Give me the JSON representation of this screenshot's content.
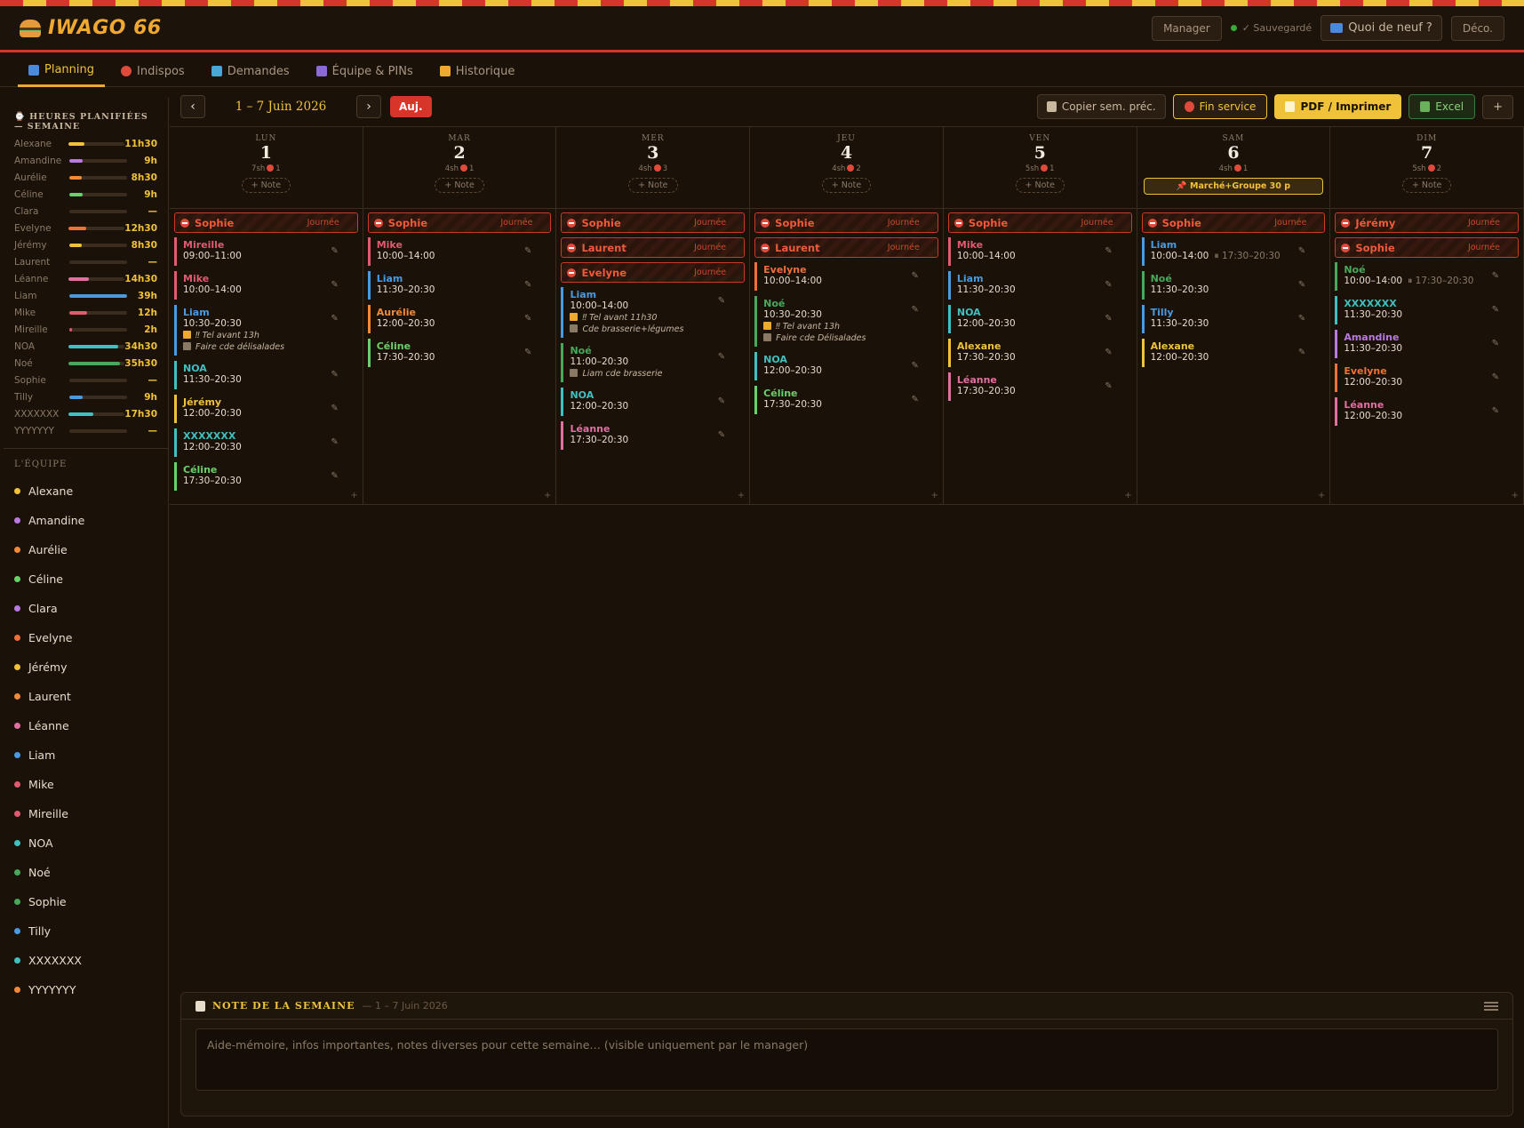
{
  "app": {
    "name": "IWAGO 66",
    "role": "Manager",
    "saved": "✓ Sauvegardé",
    "news": "Quoi de neuf ?",
    "logout": "Déco."
  },
  "tabs": [
    {
      "label": "Planning",
      "icon": "calendar-icon",
      "color": "#4a8ad8"
    },
    {
      "label": "Indispos",
      "icon": "no-entry-icon",
      "color": "#e04a3a"
    },
    {
      "label": "Demandes",
      "icon": "inbox-icon",
      "color": "#4aa8d8"
    },
    {
      "label": "Équipe & PINs",
      "icon": "people-icon",
      "color": "#8a6ad8"
    },
    {
      "label": "Historique",
      "icon": "scroll-icon",
      "color": "#f0a830"
    }
  ],
  "sidebar": {
    "hours_title": "⌚ HEURES PLANIFIÉES — SEMAINE",
    "team_title": "L'ÉQUIPE",
    "hours": [
      {
        "name": "Alexane",
        "value": "11h30",
        "ratio": 0.29,
        "color": "#f0c23a"
      },
      {
        "name": "Amandine",
        "value": "9h",
        "ratio": 0.23,
        "color": "#b87ae0"
      },
      {
        "name": "Aurélie",
        "value": "8h30",
        "ratio": 0.22,
        "color": "#f08a3a"
      },
      {
        "name": "Céline",
        "value": "9h",
        "ratio": 0.23,
        "color": "#6ad06a"
      },
      {
        "name": "Clara",
        "value": "—",
        "ratio": 0,
        "color": "#b87ae0"
      },
      {
        "name": "Evelyne",
        "value": "12h30",
        "ratio": 0.32,
        "color": "#f0703a"
      },
      {
        "name": "Jérémy",
        "value": "8h30",
        "ratio": 0.22,
        "color": "#f0c23a"
      },
      {
        "name": "Laurent",
        "value": "—",
        "ratio": 0,
        "color": "#f08a3a"
      },
      {
        "name": "Léanne",
        "value": "14h30",
        "ratio": 0.37,
        "color": "#e070a0"
      },
      {
        "name": "Liam",
        "value": "39h",
        "ratio": 1.0,
        "color": "#4a9ae0"
      },
      {
        "name": "Mike",
        "value": "12h",
        "ratio": 0.31,
        "color": "#e05a70"
      },
      {
        "name": "Mireille",
        "value": "2h",
        "ratio": 0.05,
        "color": "#e05a70"
      },
      {
        "name": "NOA",
        "value": "34h30",
        "ratio": 0.88,
        "color": "#40c0c0"
      },
      {
        "name": "Noé",
        "value": "35h30",
        "ratio": 0.91,
        "color": "#4aa85a"
      },
      {
        "name": "Sophie",
        "value": "—",
        "ratio": 0,
        "color": "#4aa85a"
      },
      {
        "name": "Tilly",
        "value": "9h",
        "ratio": 0.23,
        "color": "#4a9ae0"
      },
      {
        "name": "XXXXXXX",
        "value": "17h30",
        "ratio": 0.45,
        "color": "#40c0c0"
      },
      {
        "name": "YYYYYYY",
        "value": "—",
        "ratio": 0,
        "color": "#f08a3a"
      }
    ],
    "team": [
      {
        "name": "Alexane",
        "color": "#f0c23a"
      },
      {
        "name": "Amandine",
        "color": "#b87ae0"
      },
      {
        "name": "Aurélie",
        "color": "#f08a3a"
      },
      {
        "name": "Céline",
        "color": "#6ad06a"
      },
      {
        "name": "Clara",
        "color": "#b87ae0"
      },
      {
        "name": "Evelyne",
        "color": "#f0703a"
      },
      {
        "name": "Jérémy",
        "color": "#f0c23a"
      },
      {
        "name": "Laurent",
        "color": "#f08a3a"
      },
      {
        "name": "Léanne",
        "color": "#e070a0"
      },
      {
        "name": "Liam",
        "color": "#4a9ae0"
      },
      {
        "name": "Mike",
        "color": "#e05a70"
      },
      {
        "name": "Mireille",
        "color": "#e05a70"
      },
      {
        "name": "NOA",
        "color": "#40c0c0"
      },
      {
        "name": "Noé",
        "color": "#4aa85a"
      },
      {
        "name": "Sophie",
        "color": "#4aa85a"
      },
      {
        "name": "Tilly",
        "color": "#4a9ae0"
      },
      {
        "name": "XXXXXXX",
        "color": "#40c0c0"
      },
      {
        "name": "YYYYYYY",
        "color": "#f08a3a"
      }
    ]
  },
  "toolbar": {
    "prev": "‹",
    "next": "›",
    "range": "1 – 7 Juin 2026",
    "today": "Auj.",
    "copy": "Copier sem. préc.",
    "end_service": "Fin service",
    "pdf": "PDF / Imprimer",
    "excel": "Excel",
    "add": "+"
  },
  "days": [
    {
      "name": "LUN",
      "num": "1",
      "hours": "7sh",
      "abs": "1",
      "note": "+ Note",
      "absences": [
        {
          "name": "Sophie",
          "type": "Journée"
        }
      ],
      "shifts": [
        {
          "name": "Mireille",
          "time": "09:00–11:00",
          "color": "#e05a70"
        },
        {
          "name": "Mike",
          "time": "10:00–14:00",
          "color": "#e05a70"
        },
        {
          "name": "Liam",
          "time": "10:30–20:30",
          "color": "#4a9ae0",
          "notes": [
            "‼ Tel avant 13h",
            "Faire cde délisalades"
          ]
        },
        {
          "name": "NOA",
          "time": "11:30–20:30",
          "color": "#40c0c0"
        },
        {
          "name": "Jérémy",
          "time": "12:00–20:30",
          "color": "#f0c23a"
        },
        {
          "name": "XXXXXXX",
          "time": "12:00–20:30",
          "color": "#40c0c0"
        },
        {
          "name": "Céline",
          "time": "17:30–20:30",
          "color": "#6ad06a"
        }
      ]
    },
    {
      "name": "MAR",
      "num": "2",
      "hours": "4sh",
      "abs": "1",
      "note": "+ Note",
      "absences": [
        {
          "name": "Sophie",
          "type": "Journée"
        }
      ],
      "shifts": [
        {
          "name": "Mike",
          "time": "10:00–14:00",
          "color": "#e05a70"
        },
        {
          "name": "Liam",
          "time": "11:30–20:30",
          "color": "#4a9ae0"
        },
        {
          "name": "Aurélie",
          "time": "12:00–20:30",
          "color": "#f08a3a"
        },
        {
          "name": "Céline",
          "time": "17:30–20:30",
          "color": "#6ad06a"
        }
      ]
    },
    {
      "name": "MER",
      "num": "3",
      "hours": "4sh",
      "abs": "3",
      "note": "+ Note",
      "absences": [
        {
          "name": "Sophie",
          "type": "Journée"
        },
        {
          "name": "Laurent",
          "type": "Journée"
        },
        {
          "name": "Evelyne",
          "type": "Journée"
        }
      ],
      "shifts": [
        {
          "name": "Liam",
          "time": "10:00–14:00",
          "color": "#4a9ae0",
          "notes": [
            "‼ Tel avant 11h30",
            "Cde brasserie+légumes"
          ]
        },
        {
          "name": "Noé",
          "time": "11:00–20:30",
          "color": "#4aa85a",
          "notes": [
            "Liam cde brasserie"
          ]
        },
        {
          "name": "NOA",
          "time": "12:00–20:30",
          "color": "#40c0c0"
        },
        {
          "name": "Léanne",
          "time": "17:30–20:30",
          "color": "#e070a0"
        }
      ]
    },
    {
      "name": "JEU",
      "num": "4",
      "hours": "4sh",
      "abs": "2",
      "note": "+ Note",
      "absences": [
        {
          "name": "Sophie",
          "type": "Journée"
        },
        {
          "name": "Laurent",
          "type": "Journée"
        }
      ],
      "shifts": [
        {
          "name": "Evelyne",
          "time": "10:00–14:00",
          "color": "#f0703a"
        },
        {
          "name": "Noé",
          "time": "10:30–20:30",
          "color": "#4aa85a",
          "notes": [
            "‼ Tel avant 13h",
            "Faire cde Délisalades"
          ]
        },
        {
          "name": "NOA",
          "time": "12:00–20:30",
          "color": "#40c0c0"
        },
        {
          "name": "Céline",
          "time": "17:30–20:30",
          "color": "#6ad06a"
        }
      ]
    },
    {
      "name": "VEN",
      "num": "5",
      "hours": "5sh",
      "abs": "1",
      "note": "+ Note",
      "absences": [
        {
          "name": "Sophie",
          "type": "Journée"
        }
      ],
      "shifts": [
        {
          "name": "Mike",
          "time": "10:00–14:00",
          "color": "#e05a70"
        },
        {
          "name": "Liam",
          "time": "11:30–20:30",
          "color": "#4a9ae0"
        },
        {
          "name": "NOA",
          "time": "12:00–20:30",
          "color": "#40c0c0"
        },
        {
          "name": "Alexane",
          "time": "17:30–20:30",
          "color": "#f0c23a"
        },
        {
          "name": "Léanne",
          "time": "17:30–20:30",
          "color": "#e070a0"
        }
      ]
    },
    {
      "name": "SAM",
      "num": "6",
      "hours": "4sh",
      "abs": "1",
      "event": "📌 Marché+Groupe 30 p",
      "absences": [
        {
          "name": "Sophie",
          "type": "Journée"
        }
      ],
      "shifts": [
        {
          "name": "Liam",
          "time": "10:00–14:00",
          "time2": "⏸ 17:30–20:30",
          "color": "#4a9ae0"
        },
        {
          "name": "Noé",
          "time": "11:30–20:30",
          "color": "#4aa85a"
        },
        {
          "name": "Tilly",
          "time": "11:30–20:30",
          "color": "#4a9ae0"
        },
        {
          "name": "Alexane",
          "time": "12:00–20:30",
          "color": "#f0c23a"
        }
      ]
    },
    {
      "name": "DIM",
      "num": "7",
      "hours": "5sh",
      "abs": "2",
      "note": "+ Note",
      "absences": [
        {
          "name": "Jérémy",
          "type": "Journée"
        },
        {
          "name": "Sophie",
          "type": "Journée"
        }
      ],
      "shifts": [
        {
          "name": "Noé",
          "time": "10:00–14:00",
          "time2": "⏸ 17:30–20:30",
          "color": "#4aa85a"
        },
        {
          "name": "XXXXXXX",
          "time": "11:30–20:30",
          "color": "#40c0c0"
        },
        {
          "name": "Amandine",
          "time": "11:30–20:30",
          "color": "#b87ae0"
        },
        {
          "name": "Evelyne",
          "time": "12:00–20:30",
          "color": "#f0703a"
        },
        {
          "name": "Léanne",
          "time": "12:00–20:30",
          "color": "#e070a0"
        }
      ]
    }
  ],
  "week_note": {
    "title": "NOTE DE LA SEMAINE",
    "subtitle": "— 1 – 7 Juin 2026",
    "placeholder": "Aide-mémoire, infos importantes, notes diverses pour cette semaine… (visible uniquement par le manager)"
  }
}
